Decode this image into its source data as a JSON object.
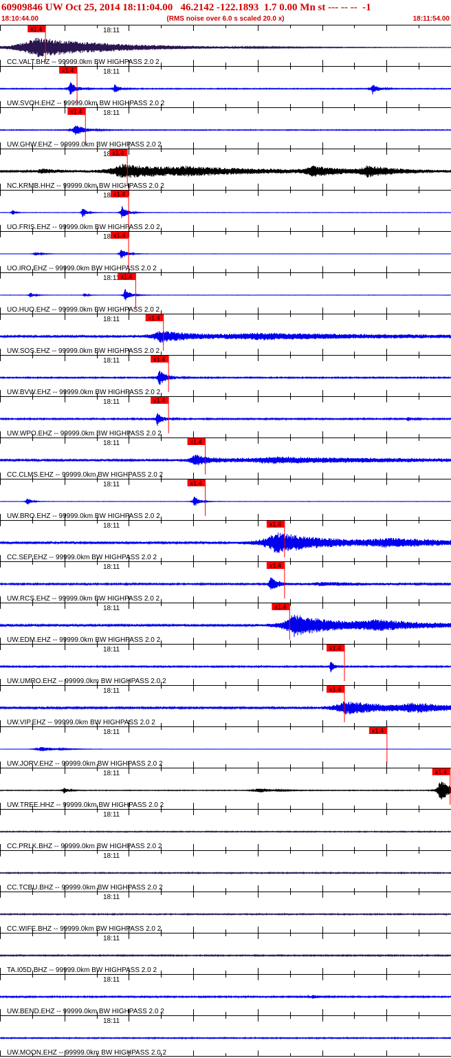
{
  "header": {
    "title": "60909846 UW Oct 25, 2014 18:11:04.00   46.2142 -122.1893  1.7 0.00 Mn st --- -- --  -1",
    "start_time": "18:10:44.00",
    "noise_note": "(RMS noise over 6.0 s scaled 20.0 x)",
    "end_time": "18:11:54.00"
  },
  "colors": {
    "header_text": "#d10000",
    "trace_blue": "#0000ee",
    "trace_black": "#000000",
    "trace_purple": "#2a1650",
    "pick_box": "#ff0000",
    "pick_line": "#ff0000",
    "axis": "#000000"
  },
  "chart_data": {
    "type": "line",
    "x_axis": {
      "unit": "seconds after 18:10:44.00",
      "range": [
        0,
        70
      ],
      "minute_label": "18:11"
    },
    "pick_label": "x1.4",
    "series": [
      {
        "label": "CC.VALT.BHZ -- 99999.0km BW  HIGHPASS  2.0  2",
        "color": "purple",
        "pick_s": 4.5,
        "bursts": [
          [
            5.6,
            16,
            9
          ]
        ],
        "noise": 0.08
      },
      {
        "label": "UW.SVOH.EHZ -- 99999.0km BW  HIGHPASS  2.0  2",
        "color": "blue",
        "pick_s": 9.4,
        "bursts": [
          [
            10.9,
            1.2,
            6
          ],
          [
            17.8,
            0.9,
            4
          ],
          [
            57.8,
            1,
            5
          ]
        ],
        "noise": 0.35
      },
      {
        "label": "UW.GHW.EHZ -- 99999.0km BW  HIGHPASS  2.0  2",
        "color": "blue",
        "pick_s": 10.7,
        "bursts": [
          [
            11.6,
            1.8,
            5
          ]
        ],
        "noise": 0.3
      },
      {
        "label": "NC.KRMB.HHZ -- 99999.0km BW  HIGHPASS  2.0  2",
        "color": "black",
        "pick_s": 17.2,
        "bursts": [
          [
            6.4,
            3,
            2
          ],
          [
            18.9,
            10,
            6
          ],
          [
            29,
            20,
            2.5
          ],
          [
            48.5,
            5,
            4
          ],
          [
            57,
            5,
            4.5
          ]
        ],
        "noise": 0.7
      },
      {
        "label": "UO.FRIS.EHZ -- 99999.0km BW  HIGHPASS  2.0  2",
        "color": "blue",
        "pick_s": 17.4,
        "bursts": [
          [
            1.9,
            0.5,
            3
          ],
          [
            12.8,
            0.7,
            5
          ],
          [
            18.9,
            1,
            6
          ]
        ],
        "noise": 0.15
      },
      {
        "label": "UO.IRO.EHZ -- 99999.0km BW  HIGHPASS  2.0  2",
        "color": "blue",
        "pick_s": 17.4,
        "bursts": [
          [
            5.5,
            1.2,
            1.5
          ],
          [
            18.8,
            1,
            5
          ]
        ],
        "noise": 0.1
      },
      {
        "label": "UO.HUO.EHZ -- 99999.0km BW  HIGHPASS  2.0  2",
        "color": "blue",
        "pick_s": 18.5,
        "bursts": [
          [
            4.7,
            0.8,
            2.5
          ],
          [
            13.1,
            0.6,
            2
          ],
          [
            19.4,
            1,
            6
          ]
        ],
        "noise": 0.12
      },
      {
        "label": "UW.SOS.EHZ -- 99999.0km BW  HIGHPASS  2.0  2",
        "color": "blue",
        "pick_s": 22.8,
        "bursts": [
          [
            24.9,
            6,
            5
          ],
          [
            40,
            30,
            2.5
          ]
        ],
        "noise": 0.8
      },
      {
        "label": "UW.BVW.EHZ -- 99999.0km BW  HIGHPASS  2.0  2",
        "color": "blue",
        "pick_s": 23.6,
        "bursts": [
          [
            24.7,
            1.5,
            7
          ]
        ],
        "noise": 0.45
      },
      {
        "label": "UW.WPO.EHZ -- 99999.0km BW  HIGHPASS  2.0  2",
        "color": "blue",
        "pick_s": 23.6,
        "bursts": [
          [
            24.4,
            1,
            6
          ],
          [
            63.3,
            0.6,
            2
          ]
        ],
        "noise": 0.5
      },
      {
        "label": "CC.CLMS.EHZ -- 99999.0km BW  HIGHPASS  2.0  2",
        "color": "blue",
        "pick_s": 29.3,
        "bursts": [
          [
            30.2,
            3,
            5
          ],
          [
            42,
            25,
            2.5
          ]
        ],
        "noise": 0.85
      },
      {
        "label": "UW.BRO.EHZ -- 99999.0km BW  HIGHPASS  2.0  2",
        "color": "blue",
        "pick_s": 29.3,
        "bursts": [
          [
            4.2,
            0.7,
            4
          ],
          [
            30.1,
            1,
            5
          ]
        ],
        "noise": 0.12
      },
      {
        "label": "CC.SEP.EHZ -- 99999.0km BW  HIGHPASS  2.0  2",
        "color": "blue",
        "pick_s": 41.6,
        "bursts": [
          [
            42.8,
            10,
            9
          ],
          [
            60,
            15,
            3
          ]
        ],
        "noise": 0.8
      },
      {
        "label": "UW.RCS.EHZ -- 99999.0km BW  HIGHPASS  2.0  2",
        "color": "blue",
        "pick_s": 41.6,
        "bursts": [
          [
            42,
            1.5,
            6
          ],
          [
            50,
            10,
            1.5
          ]
        ],
        "noise": 0.55
      },
      {
        "label": "UW.EDM.EHZ -- 99999.0km BW  HIGHPASS  2.0  2",
        "color": "blue",
        "pick_s": 42.4,
        "bursts": [
          [
            45.6,
            8,
            10
          ],
          [
            58,
            12,
            3.5
          ]
        ],
        "noise": 0.8
      },
      {
        "label": "UW.UMRO.EHZ -- 99999.0km BW  HIGHPASS  2.0  2",
        "color": "blue",
        "pick_s": 50.9,
        "bursts": [
          [
            51.3,
            0.6,
            6
          ]
        ],
        "noise": 0.5
      },
      {
        "label": "UW.VIP.EHZ -- 99999.0km BW  HIGHPASS  2.0  2",
        "color": "blue",
        "pick_s": 50.9,
        "bursts": [
          [
            53.5,
            8,
            6
          ],
          [
            64,
            10,
            3
          ]
        ],
        "noise": 0.75
      },
      {
        "label": "UW.JORV.EHZ -- 99999.0km BW  HIGHPASS  2.0  2",
        "color": "blue",
        "pick_s": 57.5,
        "bursts": [
          [
            6.3,
            3.5,
            2
          ]
        ],
        "noise": 0.05
      },
      {
        "label": "UW.TREE.HHZ -- 99999.0km BW  HIGHPASS  2.0  2",
        "color": "black",
        "pick_s": 67.3,
        "bursts": [
          [
            9.9,
            0.8,
            3
          ],
          [
            40,
            3,
            2
          ],
          [
            68.3,
            2,
            10
          ]
        ],
        "noise": 0.25
      },
      {
        "label": "CC.PRLK.BHZ -- 99999.0km BW  HIGHPASS  2.0  2",
        "color": "purple",
        "pick_s": null,
        "bursts": [],
        "noise": 0.35
      },
      {
        "label": "CC.TCBU.BHZ -- 99999.0km BW  HIGHPASS  2.0  2",
        "color": "purple",
        "pick_s": null,
        "bursts": [],
        "noise": 0.4
      },
      {
        "label": "CC.WIFE.BHZ -- 99999.0km BW  HIGHPASS  2.0  2",
        "color": "purple",
        "pick_s": null,
        "bursts": [],
        "noise": 0.4
      },
      {
        "label": "TA.I05D.BHZ -- 99999.0km BW  HIGHPASS  2.0  2",
        "color": "purple",
        "pick_s": null,
        "bursts": [],
        "noise": 0.45
      },
      {
        "label": "UW.BEND.EHZ -- 99999.0km BW  HIGHPASS  2.0  2",
        "color": "blue",
        "pick_s": null,
        "bursts": [
          [
            48.5,
            1.5,
            1.5
          ]
        ],
        "noise": 0.5
      },
      {
        "label": "UW.MOON.EHZ -- 99999.0km BW  HIGHPASS  2.0  2",
        "color": "blue",
        "pick_s": null,
        "bursts": [],
        "noise": 0.4
      }
    ]
  }
}
